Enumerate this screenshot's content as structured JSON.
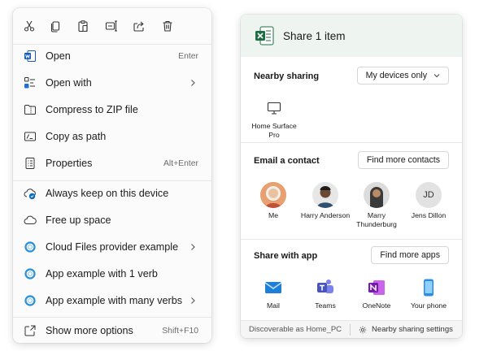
{
  "context_menu": {
    "toolbar": [
      {
        "name": "cut-icon"
      },
      {
        "name": "copy-icon"
      },
      {
        "name": "paste-icon"
      },
      {
        "name": "rename-icon"
      },
      {
        "name": "share-icon"
      },
      {
        "name": "delete-icon"
      }
    ],
    "items": [
      {
        "label": "Open",
        "shortcut": "Enter",
        "icon": "word-doc-icon"
      },
      {
        "label": "Open with",
        "icon": "open-with-icon",
        "submenu": true
      },
      {
        "label": "Compress to ZIP file",
        "icon": "zip-folder-icon"
      },
      {
        "label": "Copy as path",
        "icon": "copy-path-icon"
      },
      {
        "label": "Properties",
        "shortcut": "Alt+Enter",
        "icon": "properties-icon"
      },
      {
        "label": "Always keep on this device",
        "icon": "cloud-check-icon"
      },
      {
        "label": "Free up space",
        "icon": "cloud-icon"
      },
      {
        "label": "Cloud Files provider example",
        "icon": "ring-icon",
        "submenu": true
      },
      {
        "label": "App example with 1 verb",
        "icon": "ring-icon"
      },
      {
        "label": "App example with many verbs",
        "icon": "ring-icon",
        "submenu": true
      },
      {
        "label": "Show more options",
        "shortcut": "Shift+F10",
        "icon": "show-more-icon"
      }
    ]
  },
  "share_panel": {
    "title": "Share 1 item",
    "nearby": {
      "label": "Nearby sharing",
      "dropdown_value": "My devices only",
      "devices": [
        {
          "name": "Home Surface Pro"
        }
      ]
    },
    "email": {
      "label": "Email a contact",
      "button": "Find more contacts",
      "contacts": [
        {
          "name": "Me"
        },
        {
          "name": "Harry Anderson"
        },
        {
          "name": "Marry Thunderburg"
        },
        {
          "name": "Jens Dillon",
          "initials": "JD"
        }
      ]
    },
    "apps": {
      "label": "Share with app",
      "button": "Find more apps",
      "list": [
        {
          "name": "Mail",
          "icon": "mail-icon"
        },
        {
          "name": "Teams",
          "icon": "teams-icon"
        },
        {
          "name": "OneNote",
          "icon": "onenote-icon"
        },
        {
          "name": "Your phone",
          "icon": "phone-icon"
        }
      ]
    },
    "footer": {
      "discoverable": "Discoverable as Home_PC",
      "settings": "Nearby sharing settings"
    }
  }
}
